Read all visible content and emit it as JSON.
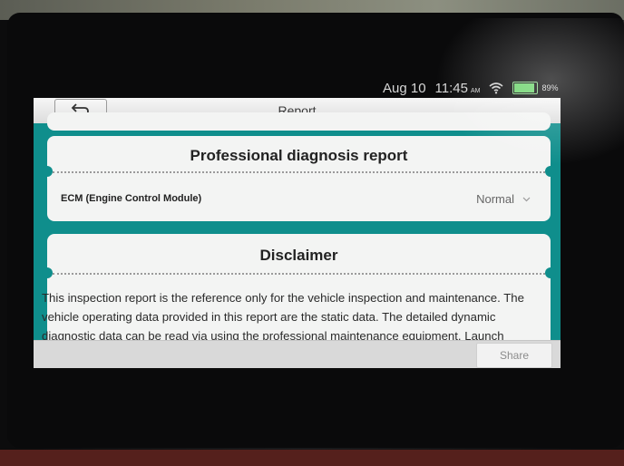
{
  "status_bar": {
    "date": "Aug 10",
    "time": "11:45",
    "ampm": "AM",
    "battery_pct": "89%",
    "battery_level": 0.89
  },
  "header": {
    "title": "Report",
    "back_icon": "back-arrow-icon"
  },
  "sections": {
    "diagnosis": {
      "title": "Professional diagnosis report",
      "rows": [
        {
          "label": "ECM (Engine Control Module)",
          "value": "Normal"
        }
      ]
    },
    "disclaimer": {
      "title": "Disclaimer",
      "line1": "This inspection report is the reference only for the vehicle inspection and maintenance. The",
      "line2": "vehicle operating data provided in this report are the static data. The detailed dynamic",
      "line3": "diagnostic data can be read via using the professional maintenance equipment. Launch"
    }
  },
  "footer": {
    "share_label": "Share"
  },
  "colors": {
    "accent_teal": "#0f8e8c",
    "battery_green": "#6bd36b"
  }
}
